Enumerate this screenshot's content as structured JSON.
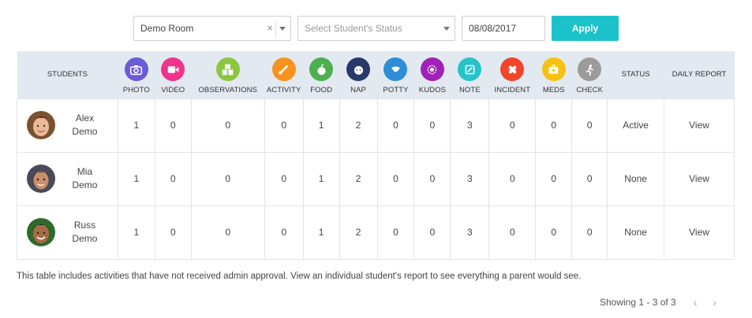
{
  "filters": {
    "room_value": "Demo Room",
    "clear_symbol": "×",
    "status_placeholder": "Select Student's Status",
    "date_value": "08/08/2017",
    "apply_label": "Apply"
  },
  "colors": {
    "apply": "#1cc2c9",
    "header_bg": "#e3e9f0",
    "photo": "#6b5bd6",
    "video": "#f0338c",
    "observations": "#8cc63f",
    "activity": "#f7931e",
    "food": "#4caf50",
    "nap": "#283a6b",
    "potty": "#2e8cd8",
    "kudos": "#a020b8",
    "note": "#27c3c9",
    "incident": "#f0452a",
    "meds": "#f7c20f",
    "check": "#9b9b9b"
  },
  "table": {
    "headers": {
      "students": "STUDENTS",
      "photo": "PHOTO",
      "video": "VIDEO",
      "observations": "OBSERVATIONS",
      "activity": "ACTIVITY",
      "food": "FOOD",
      "nap": "NAP",
      "potty": "POTTY",
      "kudos": "KUDOS",
      "note": "NOTE",
      "incident": "INCIDENT",
      "meds": "MEDS",
      "check": "CHECK",
      "status": "STATUS",
      "daily_report": "DAILY REPORT"
    },
    "icons": {
      "photo": "camera-icon",
      "video": "video-camera-icon",
      "observations": "blocks-icon",
      "activity": "paintbrush-icon",
      "food": "apple-icon",
      "nap": "sleeping-face-icon",
      "potty": "potty-icon",
      "kudos": "badge-icon",
      "note": "pencil-note-icon",
      "incident": "bandage-icon",
      "meds": "first-aid-kit-icon",
      "check": "running-person-icon"
    },
    "rows": [
      {
        "first": "Alex",
        "last": "Demo",
        "photo": "1",
        "video": "0",
        "observations": "0",
        "activity": "0",
        "food": "1",
        "nap": "2",
        "potty": "0",
        "kudos": "0",
        "note": "3",
        "incident": "0",
        "meds": "0",
        "check": "0",
        "status": "Active",
        "report": "View"
      },
      {
        "first": "Mia",
        "last": "Demo",
        "photo": "1",
        "video": "0",
        "observations": "0",
        "activity": "0",
        "food": "1",
        "nap": "2",
        "potty": "0",
        "kudos": "0",
        "note": "3",
        "incident": "0",
        "meds": "0",
        "check": "0",
        "status": "None",
        "report": "View"
      },
      {
        "first": "Russ",
        "last": "Demo",
        "photo": "1",
        "video": "0",
        "observations": "0",
        "activity": "0",
        "food": "1",
        "nap": "2",
        "potty": "0",
        "kudos": "0",
        "note": "3",
        "incident": "0",
        "meds": "0",
        "check": "0",
        "status": "None",
        "report": "View"
      }
    ]
  },
  "footer_note": "This table includes activities that have not received admin approval. View an individual student's report to see everything a parent would see.",
  "pagination": {
    "summary": "Showing 1 - 3 of 3",
    "prev": "‹",
    "next": "›"
  }
}
